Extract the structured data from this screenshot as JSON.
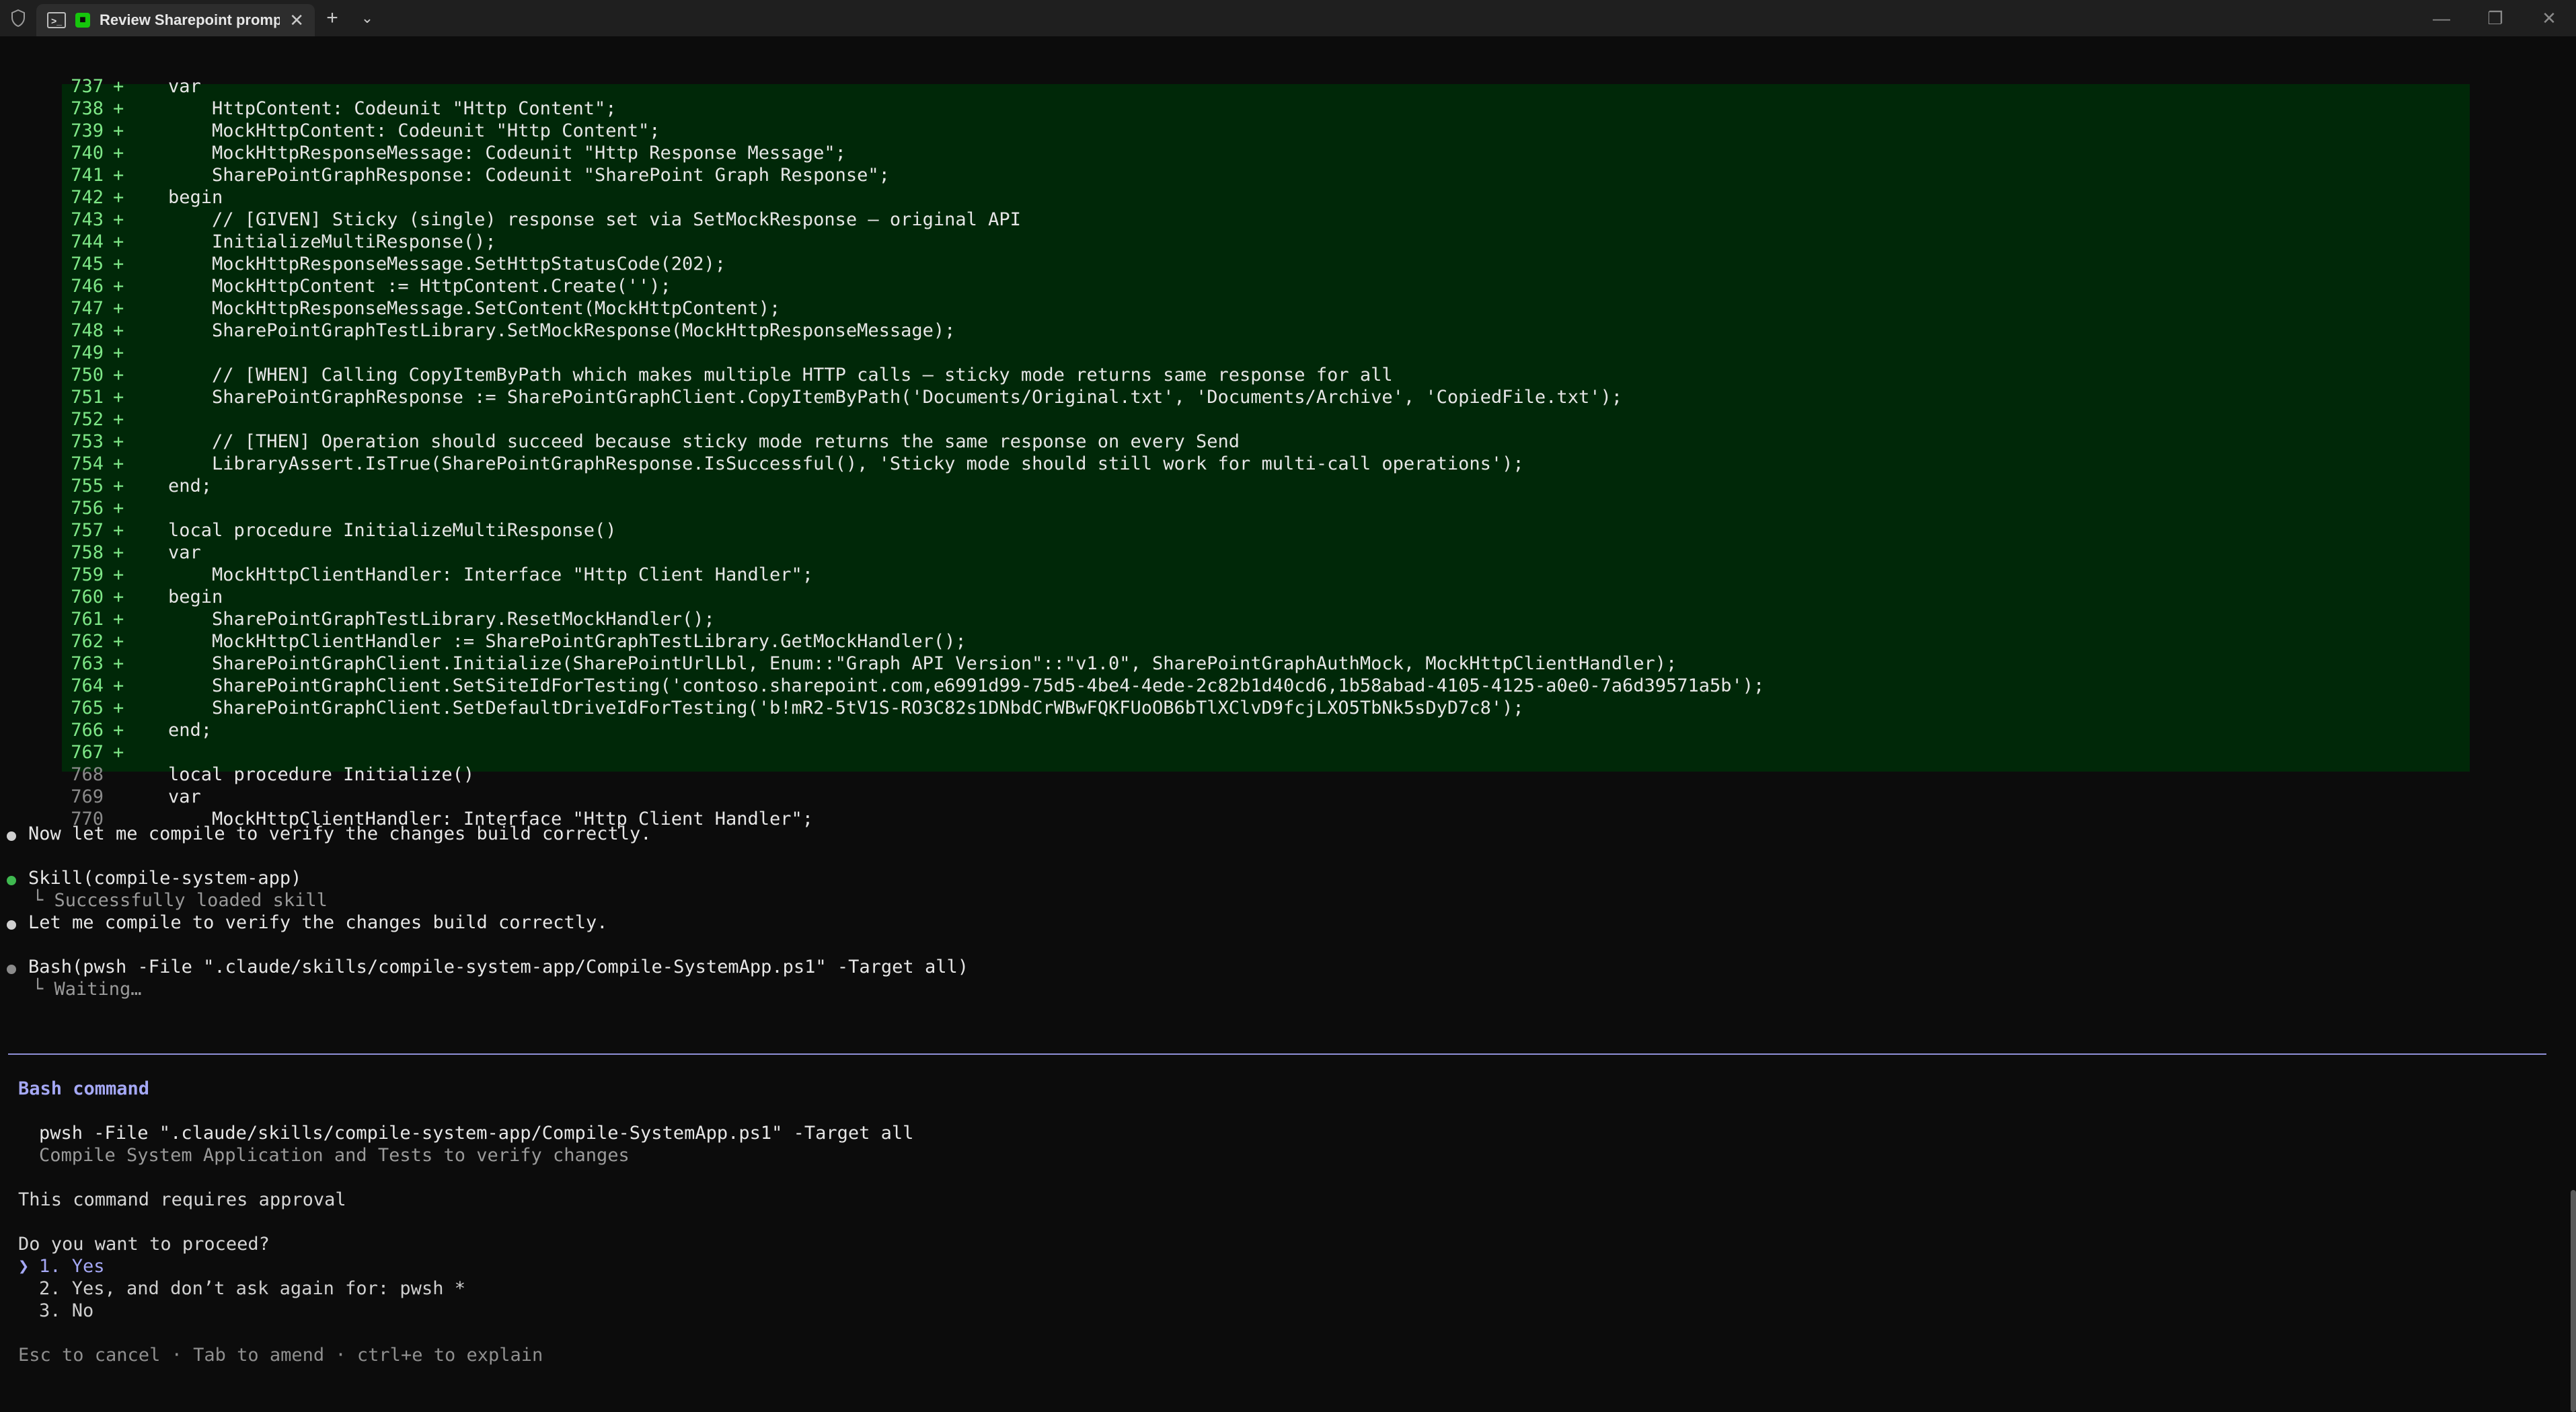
{
  "titlebar": {
    "tab_title": "Review Sharepoint promp",
    "tab_close": "✕",
    "new_tab": "+",
    "dropdown": "⌄",
    "minimize": "—",
    "restore": "❐",
    "close": "✕"
  },
  "diff": {
    "lines": [
      {
        "num": "737",
        "sign": "+",
        "text": "var"
      },
      {
        "num": "738",
        "sign": "+",
        "text": "    HttpContent: Codeunit \"Http Content\";"
      },
      {
        "num": "739",
        "sign": "+",
        "text": "    MockHttpContent: Codeunit \"Http Content\";"
      },
      {
        "num": "740",
        "sign": "+",
        "text": "    MockHttpResponseMessage: Codeunit \"Http Response Message\";"
      },
      {
        "num": "741",
        "sign": "+",
        "text": "    SharePointGraphResponse: Codeunit \"SharePoint Graph Response\";"
      },
      {
        "num": "742",
        "sign": "+",
        "text": "begin"
      },
      {
        "num": "743",
        "sign": "+",
        "text": "    // [GIVEN] Sticky (single) response set via SetMockResponse — original API"
      },
      {
        "num": "744",
        "sign": "+",
        "text": "    InitializeMultiResponse();"
      },
      {
        "num": "745",
        "sign": "+",
        "text": "    MockHttpResponseMessage.SetHttpStatusCode(202);"
      },
      {
        "num": "746",
        "sign": "+",
        "text": "    MockHttpContent := HttpContent.Create('');"
      },
      {
        "num": "747",
        "sign": "+",
        "text": "    MockHttpResponseMessage.SetContent(MockHttpContent);"
      },
      {
        "num": "748",
        "sign": "+",
        "text": "    SharePointGraphTestLibrary.SetMockResponse(MockHttpResponseMessage);"
      },
      {
        "num": "749",
        "sign": "+",
        "text": ""
      },
      {
        "num": "750",
        "sign": "+",
        "text": "    // [WHEN] Calling CopyItemByPath which makes multiple HTTP calls — sticky mode returns same response for all"
      },
      {
        "num": "751",
        "sign": "+",
        "text": "    SharePointGraphResponse := SharePointGraphClient.CopyItemByPath('Documents/Original.txt', 'Documents/Archive', 'CopiedFile.txt');"
      },
      {
        "num": "752",
        "sign": "+",
        "text": ""
      },
      {
        "num": "753",
        "sign": "+",
        "text": "    // [THEN] Operation should succeed because sticky mode returns the same response on every Send"
      },
      {
        "num": "754",
        "sign": "+",
        "text": "    LibraryAssert.IsTrue(SharePointGraphResponse.IsSuccessful(), 'Sticky mode should still work for multi-call operations');"
      },
      {
        "num": "755",
        "sign": "+",
        "text": "end;"
      },
      {
        "num": "756",
        "sign": "+",
        "text": ""
      },
      {
        "num": "757",
        "sign": "+",
        "text": "local procedure InitializeMultiResponse()"
      },
      {
        "num": "758",
        "sign": "+",
        "text": "var"
      },
      {
        "num": "759",
        "sign": "+",
        "text": "    MockHttpClientHandler: Interface \"Http Client Handler\";"
      },
      {
        "num": "760",
        "sign": "+",
        "text": "begin"
      },
      {
        "num": "761",
        "sign": "+",
        "text": "    SharePointGraphTestLibrary.ResetMockHandler();"
      },
      {
        "num": "762",
        "sign": "+",
        "text": "    MockHttpClientHandler := SharePointGraphTestLibrary.GetMockHandler();"
      },
      {
        "num": "763",
        "sign": "+",
        "text": "    SharePointGraphClient.Initialize(SharePointUrlLbl, Enum::\"Graph API Version\"::\"v1.0\", SharePointGraphAuthMock, MockHttpClientHandler);"
      },
      {
        "num": "764",
        "sign": "+",
        "text": "    SharePointGraphClient.SetSiteIdForTesting('contoso.sharepoint.com,e6991d99-75d5-4be4-4ede-2c82b1d40cd6,1b58abad-4105-4125-a0e0-7a6d39571a5b');"
      },
      {
        "num": "765",
        "sign": "+",
        "text": "    SharePointGraphClient.SetDefaultDriveIdForTesting('b!mR2-5tV1S-RO3C82s1DNbdCrWBwFQKFUoOB6bTlXClvD9fcjLXO5TbNk5sDyD7c8');"
      },
      {
        "num": "766",
        "sign": "+",
        "text": "end;"
      },
      {
        "num": "767",
        "sign": "+",
        "text": ""
      }
    ],
    "context_lines": [
      {
        "num": "768",
        "text": "local procedure Initialize()"
      },
      {
        "num": "769",
        "text": "var"
      },
      {
        "num": "770",
        "text": "    MockHttpClientHandler: Interface \"Http Client Handler\";"
      }
    ]
  },
  "messages": {
    "m1": "Now let me compile to verify the changes build correctly.",
    "skill_call": "Skill(compile-system-app)",
    "skill_result": "└ Successfully loaded skill",
    "m2": "Let me compile to verify the changes build correctly.",
    "bash_call": "Bash(pwsh -File \".claude/skills/compile-system-app/Compile-SystemApp.ps1\" -Target all)",
    "bash_status": "└ Waiting…"
  },
  "prompt": {
    "title": "Bash command",
    "command": "pwsh -File \".claude/skills/compile-system-app/Compile-SystemApp.ps1\" -Target all",
    "description": "Compile System Application and Tests to verify changes",
    "approval_note": "This command requires approval",
    "question": "Do you want to proceed?",
    "caret": "❯",
    "options": [
      "1. Yes",
      "2. Yes, and don’t ask again for: pwsh *",
      "3. No"
    ],
    "hint": "Esc to cancel · Tab to amend · ctrl+e to explain"
  },
  "colors": {
    "diff_added_bg": "#002808",
    "diff_added_fg": "#7ee787",
    "accent": "#a5a8f5",
    "terminal_bg": "#0c0c0c"
  }
}
